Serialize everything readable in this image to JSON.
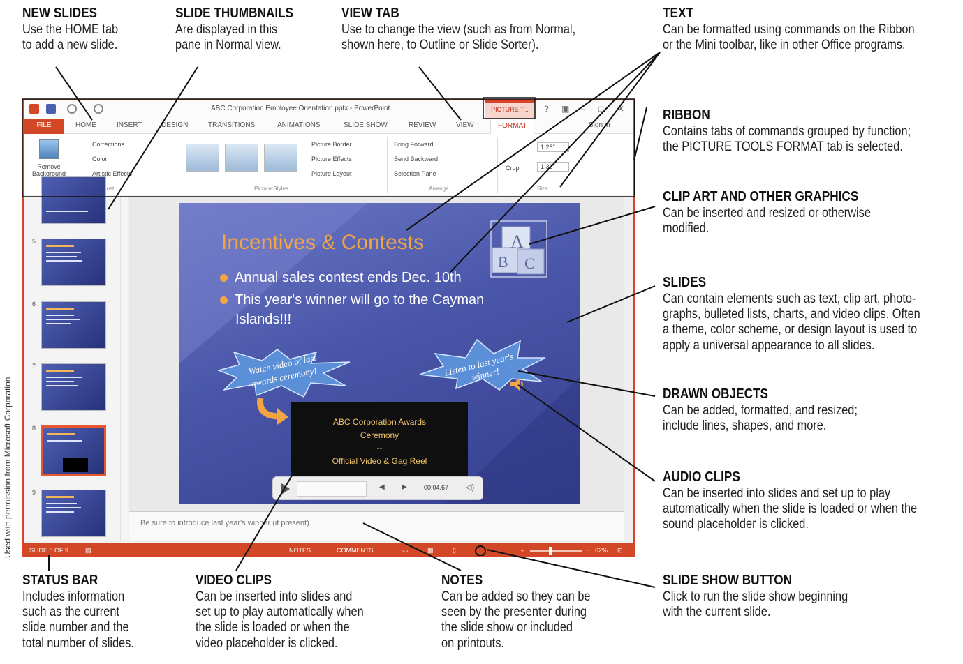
{
  "callouts": {
    "new_slides": {
      "title": "NEW SLIDES",
      "body": "Use the HOME tab\nto add a new slide."
    },
    "slide_thumbnails": {
      "title": "SLIDE THUMBNAILS",
      "body": "Are displayed in this\npane in Normal view."
    },
    "view_tab": {
      "title": "VIEW TAB",
      "body": "Use to change the view (such as from Normal,\nshown here, to Outline or Slide Sorter)."
    },
    "text": {
      "title": "TEXT",
      "body": "Can be formatted using commands on the Ribbon\nor the Mini toolbar, like in other Office programs."
    },
    "ribbon": {
      "title": "RIBBON",
      "body": "Contains tabs of commands grouped by function;\nthe PICTURE TOOLS FORMAT tab is selected."
    },
    "clip_art": {
      "title": "CLIP ART AND OTHER GRAPHICS",
      "body": "Can be inserted and resized or otherwise\nmodified."
    },
    "slides": {
      "title": "SLIDES",
      "body": "Can contain elements such as text, clip art, photo-\ngraphs, bulleted lists, charts, and video clips. Often\na theme, color scheme, or design layout is used to\napply a universal appearance to all slides."
    },
    "drawn_objects": {
      "title": "DRAWN OBJECTS",
      "body": "Can be added, formatted, and resized;\ninclude lines, shapes, and more."
    },
    "audio_clips": {
      "title": "AUDIO CLIPS",
      "body": "Can be inserted into slides and set up to play\nautomatically when the slide is loaded or when the\nsound placeholder is clicked."
    },
    "status_bar": {
      "title": "STATUS BAR",
      "body": "Includes information\nsuch as the current\nslide number and the\ntotal number of slides."
    },
    "video_clips": {
      "title": "VIDEO CLIPS",
      "body": "Can be inserted into slides and\nset up to play automatically when\nthe slide is loaded or when the\nvideo placeholder is clicked."
    },
    "notes": {
      "title": "NOTES",
      "body": "Can be added so they can be\nseen by the presenter during\nthe slide show or included\non printouts."
    },
    "slide_show_button": {
      "title": "SLIDE SHOW BUTTON",
      "body": "Click to run the slide show beginning\nwith the current slide."
    }
  },
  "credit": "Used with permission from Microsoft Corporation",
  "window": {
    "title": "ABC Corporation Employee Orientation.pptx - PowerPoint",
    "context_tab": "PICTURE T...",
    "tabs": [
      "FILE",
      "HOME",
      "INSERT",
      "DESIGN",
      "TRANSITIONS",
      "ANIMATIONS",
      "SLIDE SHOW",
      "REVIEW",
      "VIEW",
      "FORMAT"
    ],
    "sign_in": "Sign in",
    "ribbon": {
      "remove_background": "Remove Background",
      "corrections": "Corrections",
      "color": "Color",
      "artistic_effects": "Artistic Effects",
      "picture_border": "Picture Border",
      "picture_effects": "Picture Effects",
      "picture_layout": "Picture Layout",
      "bring_forward": "Bring Forward",
      "send_backward": "Send Backward",
      "selection_pane": "Selection Pane",
      "crop": "Crop",
      "height": "1.25\"",
      "width": "1.36\"",
      "group_adjust": "Adjust",
      "group_picture_styles": "Picture Styles",
      "group_arrange": "Arrange",
      "group_size": "Size"
    },
    "thumbnails": [
      "5",
      "6",
      "7",
      "8",
      "9"
    ],
    "slide": {
      "title": "Incentives & Contests",
      "bullet_1": "Annual sales contest ends Dec. 10th",
      "bullet_2": "This year's winner will go to the Cayman",
      "bullet_2_cont": "Islands!!!",
      "burst_left_1": "Watch video of last",
      "burst_left_2": "awards ceremony!",
      "burst_right_1": "Listen to last year's",
      "burst_right_2": "winner!",
      "video_line_1": "ABC Corporation Awards",
      "video_line_2": "Ceremony",
      "video_line_3": "--",
      "video_line_4": "Official Video & Gag Reel",
      "video_time": "00:04.67"
    },
    "notes_text": "Be sure to introduce last year's winner (if present).",
    "status": {
      "slide_of": "SLIDE 8 OF 9",
      "notes": "NOTES",
      "comments": "COMMENTS",
      "zoom": "62%"
    }
  },
  "colors": {
    "accent": "#d24726",
    "slide_title": "#f3a541",
    "slide_bg": "#4a56a8",
    "burst": "#5b8fd8"
  }
}
